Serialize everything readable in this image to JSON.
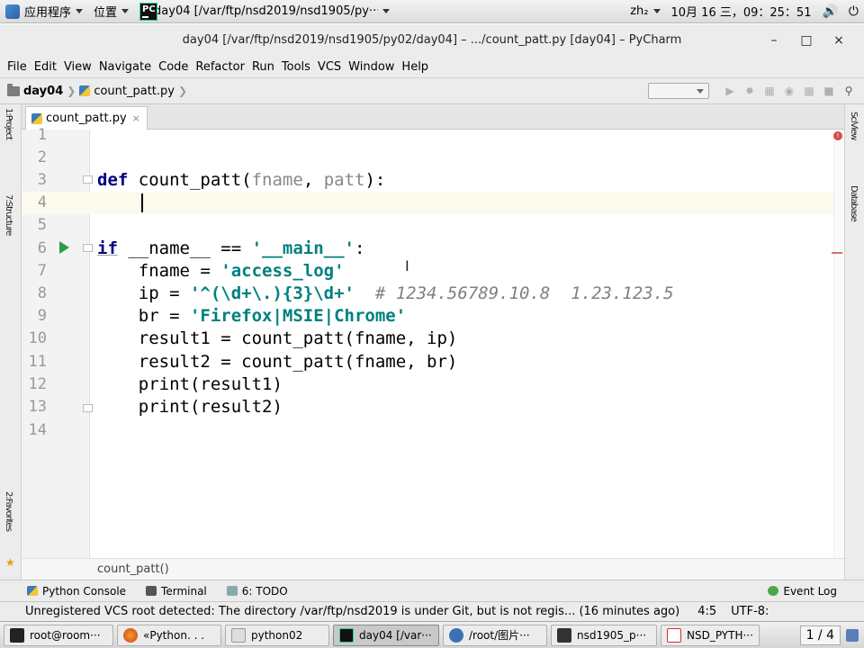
{
  "topbar": {
    "apps_label": "应用程序",
    "places_label": "位置",
    "window_label": "day04 [/var/ftp/nsd2019/nsd1905/py···",
    "input_method": "zh₂",
    "clock": "10月 16 三，09：25：51"
  },
  "window": {
    "title": "day04 [/var/ftp/nsd2019/nsd1905/py02/day04] – .../count_patt.py [day04] – PyCharm",
    "minimize": "–",
    "maximize": "□",
    "close": "×"
  },
  "menu": {
    "file": "File",
    "edit": "Edit",
    "view": "View",
    "navigate": "Navigate",
    "code": "Code",
    "refactor": "Refactor",
    "run": "Run",
    "tools": "Tools",
    "vcs": "VCS",
    "window": "Window",
    "help": "Help"
  },
  "nav": {
    "project": "day04",
    "file": "count_patt.py"
  },
  "tab": {
    "label": "count_patt.py",
    "close": "×"
  },
  "editor": {
    "line_numbers": [
      "1",
      "2",
      "3",
      "4",
      "5",
      "6",
      "7",
      "8",
      "9",
      "10",
      "11",
      "12",
      "13",
      "14"
    ],
    "code": {
      "l3_def": "def",
      "l3_name": " count_patt(",
      "l3_p1": "fname",
      "l3_comma": ", ",
      "l3_p2": "patt",
      "l3_end": "):",
      "l6_if": "if",
      "l6_rest": " __name__ == ",
      "l6_str": "'__main__'",
      "l6_end": ":",
      "l7_var": "    fname = ",
      "l7_str": "'access_log'",
      "l8_var": "    ip = ",
      "l8_str": "'^(\\d+\\.){3}\\d+'",
      "l8_cmt": "  # 1234.56789.10.8  1.23.123.5",
      "l9_var": "    br = ",
      "l9_str": "'Firefox|MSIE|Chrome'",
      "l10": "    result1 = count_patt(fname, ip)",
      "l11": "    result2 = count_patt(fname, br)",
      "l12": "    print(result1)",
      "l13": "    print(result2)"
    },
    "breadcrumb": "count_patt()"
  },
  "tool_windows": {
    "python_console": "Python Console",
    "terminal": "Terminal",
    "todo": "6: TODO",
    "event_log": "Event Log"
  },
  "status": {
    "message": "Unregistered VCS root detected: The directory /var/ftp/nsd2019 is under Git, but is not regis... (16 minutes ago)",
    "position": "4:5",
    "encoding": "UTF-8:"
  },
  "taskbar": {
    "items": [
      "root@room···",
      "«Python. . .",
      "python02",
      "day04 [/var···",
      "/root/图片···",
      "nsd1905_p···",
      "NSD_PYTH···"
    ],
    "workspace": "1 / 4"
  },
  "colors": {
    "keyword": "#000080",
    "string": "#008080",
    "comment": "#808080",
    "run_arrow": "#2e9b45"
  }
}
